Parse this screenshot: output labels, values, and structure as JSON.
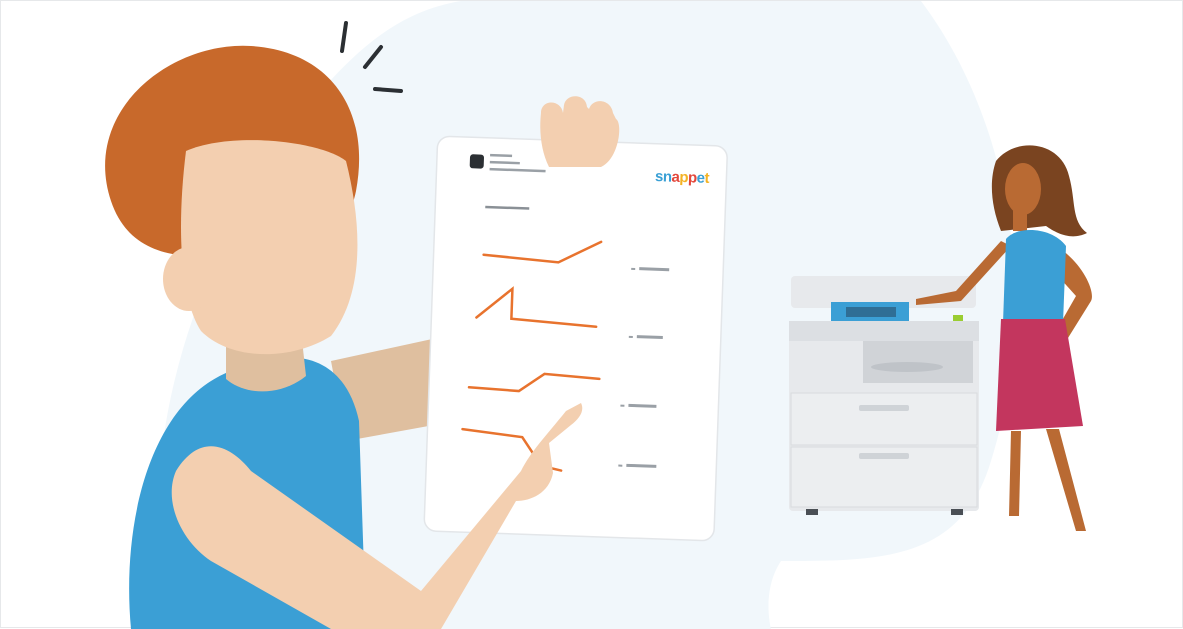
{
  "illustration": {
    "logo_text": "snappet",
    "logo_letters": [
      {
        "ch": "s",
        "color": "#3aa0d5"
      },
      {
        "ch": "n",
        "color": "#3aa0d5"
      },
      {
        "ch": "a",
        "color": "#e3473b"
      },
      {
        "ch": "p",
        "color": "#f4b324"
      },
      {
        "ch": "p",
        "color": "#e3473b"
      },
      {
        "ch": "e",
        "color": "#3aa0d5"
      },
      {
        "ch": "t",
        "color": "#f4b324"
      }
    ],
    "colors": {
      "background_blob": "#f1f7fb",
      "hair_boy": "#c8692b",
      "skin_boy": "#f3cfb0",
      "arm_back": "#dfbf9f",
      "shirt_blue": "#3b9fd5",
      "skin_girl": "#b96a33",
      "hair_girl": "#7a4420",
      "skirt": "#c3365e",
      "printer_body": "#e7e9ec",
      "line_orange": "#e8732e"
    }
  }
}
